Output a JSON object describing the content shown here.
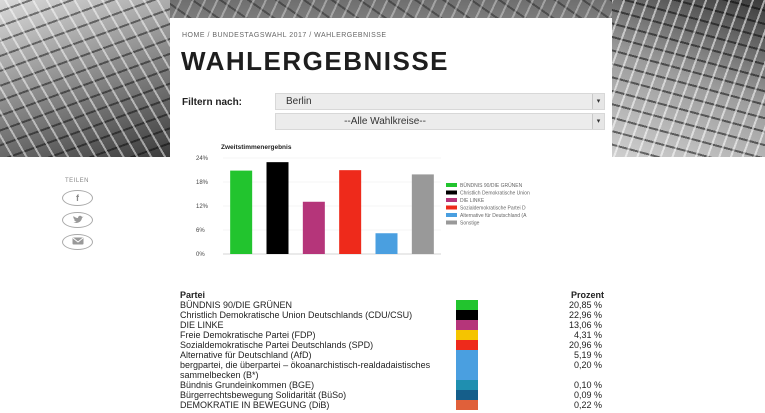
{
  "breadcrumb": "HOME / BUNDESTAGSWAHL 2017 / WAHLERGEBNISSE",
  "title": "WAHLERGEBNISSE",
  "filter": {
    "label": "Filtern nach:",
    "state": "Berlin",
    "district": "--Alle Wahlkreise--"
  },
  "share": {
    "label": "TEILEN",
    "facebook": "f",
    "twitter": "t",
    "email": "✉"
  },
  "chart_data": {
    "type": "bar",
    "title": "Zweitstimmenergebnis",
    "categories": [
      "BÜNDNIS 90/DIE GRÜNEN",
      "Christlich Demokratische Union",
      "DIE LINKE",
      "Sozialdemokratische Partei D",
      "Alternative für Deutschland (A",
      "Sonstige"
    ],
    "values": [
      20.85,
      22.96,
      13.06,
      20.96,
      5.19,
      19.9
    ],
    "colors": [
      "#22c42e",
      "#000000",
      "#b5357a",
      "#ee2a1b",
      "#4a9fe0",
      "#999999"
    ],
    "ylim": [
      0,
      24
    ],
    "yticks": [
      "24%",
      "18%",
      "12%",
      "6%",
      "0%"
    ],
    "ytick_values": [
      24,
      18,
      12,
      6,
      0
    ],
    "legend": "right"
  },
  "table": {
    "col_party": "Partei",
    "col_pct": "Prozent",
    "rows": [
      {
        "name": "BÜNDNIS 90/DIE GRÜNEN",
        "pct": "20,85 %",
        "color": "#22c42e"
      },
      {
        "name": "Christlich Demokratische Union Deutschlands (CDU/CSU)",
        "pct": "22,96 %",
        "color": "#000000"
      },
      {
        "name": "DIE LINKE",
        "pct": "13,06 %",
        "color": "#b5357a"
      },
      {
        "name": "Freie Demokratische Partei (FDP)",
        "pct": "4,31 %",
        "color": "#f5c400"
      },
      {
        "name": "Sozialdemokratische Partei Deutschlands (SPD)",
        "pct": "20,96 %",
        "color": "#ee2a1b"
      },
      {
        "name": "Alternative für Deutschland (AfD)",
        "pct": "5,19 %",
        "color": "#4a9fe0"
      },
      {
        "name": "bergpartei, die überpartei – ökoanarchistisch-realdadaistisches sammelbecken (B*)",
        "pct": "0,20 %",
        "color": "#4a9fe0"
      },
      {
        "name": "Bündnis Grundeinkommen (BGE)",
        "pct": "0,10 %",
        "color": "#1f8fb0"
      },
      {
        "name": "Bürgerrechtsbewegung Solidarität (BüSo)",
        "pct": "0,09 %",
        "color": "#155e8a"
      },
      {
        "name": "DEMOKRATIE IN BEWEGUNG (DiB)",
        "pct": "0,22 %",
        "color": "#e0603a"
      }
    ]
  }
}
